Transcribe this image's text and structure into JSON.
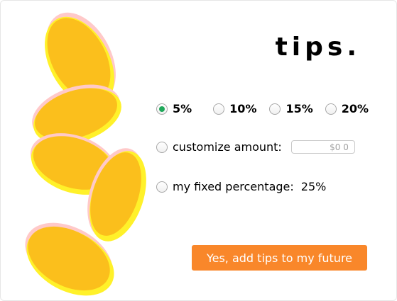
{
  "title": "tips.",
  "options": [
    {
      "label": "5%",
      "checked": true
    },
    {
      "label": "10%",
      "checked": false
    },
    {
      "label": "15%",
      "checked": false
    },
    {
      "label": "20%",
      "checked": false
    }
  ],
  "custom": {
    "label": "customize amount:",
    "placeholder": "$0 0"
  },
  "fixed": {
    "label": "my fixed percentage:",
    "value": "25%"
  },
  "cta_label": "Yes, add tips to my future",
  "colors": {
    "accent": "#f9872a",
    "radio_selected": "#1fa85a",
    "coin_fill": "#fbbf1c",
    "coin_edge": "#fff12a",
    "coin_glow": "#ffc9c9"
  }
}
